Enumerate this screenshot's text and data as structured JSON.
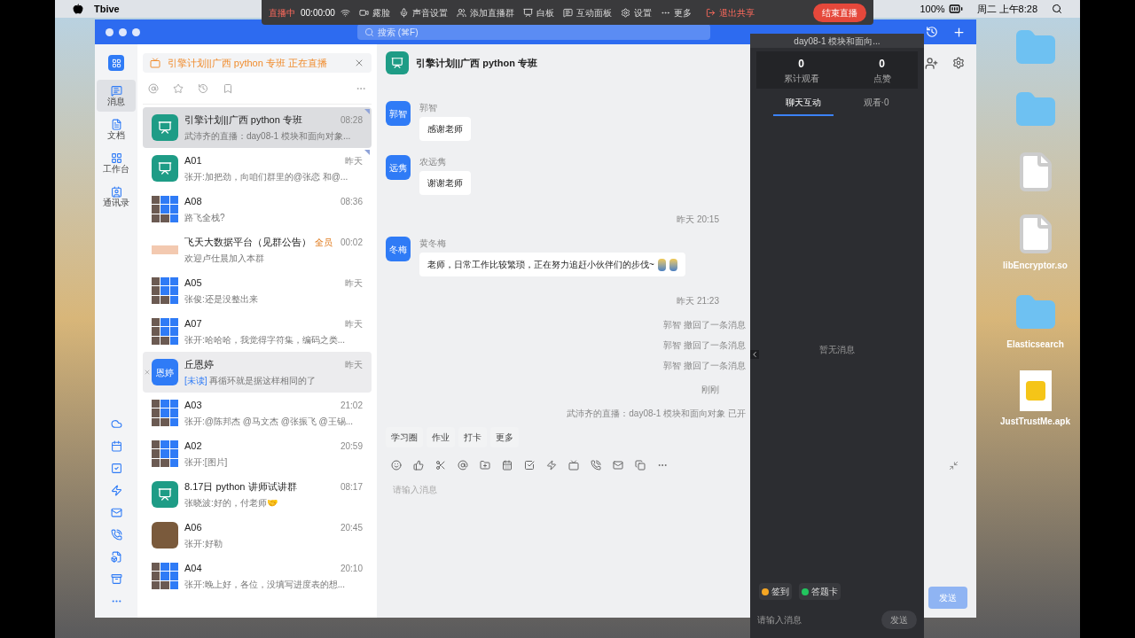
{
  "menubar": {
    "app_name": "Tbive",
    "battery": "100%",
    "clock": "周二 上午8:28"
  },
  "live_toolbar": {
    "status": "直播中",
    "timer": "00:00:00",
    "items": [
      {
        "kind": "camera",
        "label": "露脸"
      },
      {
        "kind": "mic",
        "label": "声音设置"
      },
      {
        "kind": "group",
        "label": "添加直播群"
      },
      {
        "kind": "board",
        "label": "白板"
      },
      {
        "kind": "chat",
        "label": "互动面板"
      },
      {
        "kind": "settings",
        "label": "设置"
      },
      {
        "kind": "more",
        "label": "更多"
      }
    ],
    "share": "退出共享",
    "end": "结束直播"
  },
  "app": {
    "search_placeholder": "搜索 (⌘F)",
    "nav": [
      {
        "kind": "message",
        "label": "消息",
        "selected": true
      },
      {
        "kind": "doc",
        "label": "文档",
        "selected": false
      },
      {
        "kind": "workbench",
        "label": "工作台",
        "selected": false
      },
      {
        "kind": "contacts",
        "label": "通讯录",
        "selected": false
      }
    ],
    "banner": "引擎计划||广西 python 专班 正在直播",
    "conversations": [
      {
        "avatar": {
          "kind": "group"
        },
        "name": "引擎计划||广西 python 专班",
        "preview": "武沛齐的直播：day08-1 模块和面向对象...",
        "time": "08:28",
        "selected": true,
        "hovered": false,
        "flagged": true
      },
      {
        "avatar": {
          "kind": "group"
        },
        "name": "A01",
        "preview": "张开:加把劲，向咱们群里的@张恋 和@...",
        "time": "昨天",
        "selected": false,
        "hovered": false,
        "flagged": true
      },
      {
        "avatar": {
          "kind": "grid"
        },
        "name": "A08",
        "preview": "路飞全栈?",
        "time": "08:36",
        "selected": false,
        "hovered": false,
        "flagged": false
      },
      {
        "avatar": {
          "kind": "logo"
        },
        "name": "飞天大数据平台（见群公告）",
        "tag": "全员",
        "preview": "欢迎卢仕晨加入本群",
        "time": "00:02",
        "selected": false,
        "hovered": false,
        "flagged": false
      },
      {
        "avatar": {
          "kind": "grid"
        },
        "name": "A05",
        "preview": "张俊:还是没整出来",
        "time": "昨天",
        "selected": false,
        "hovered": false,
        "flagged": false
      },
      {
        "avatar": {
          "kind": "grid"
        },
        "name": "A07",
        "preview": "张开:哈哈哈，我觉得字符集，编码之类...",
        "time": "昨天",
        "selected": false,
        "hovered": false,
        "flagged": false
      },
      {
        "avatar": {
          "kind": "initials",
          "text": "恩婷"
        },
        "name": "丘恩婷",
        "prefix": "[未读]",
        "preview": "再循环就是据这样相同的了",
        "time": "昨天",
        "selected": false,
        "hovered": true,
        "flagged": false
      },
      {
        "avatar": {
          "kind": "grid"
        },
        "name": "A03",
        "preview": "张开:@陈邦杰 @马文杰 @张振飞 @王锡...",
        "time": "21:02",
        "selected": false,
        "hovered": false,
        "flagged": false
      },
      {
        "avatar": {
          "kind": "grid"
        },
        "name": "A02",
        "preview": "张开:[图片]",
        "time": "20:59",
        "selected": false,
        "hovered": false,
        "flagged": false
      },
      {
        "avatar": {
          "kind": "group"
        },
        "name": "8.17日 python 讲师试讲群",
        "preview": "张晓波:好的，付老师🤝",
        "time": "08:17",
        "selected": false,
        "hovered": false,
        "flagged": false
      },
      {
        "avatar": {
          "kind": "photo"
        },
        "name": "A06",
        "preview": "张开:好勒",
        "time": "20:45",
        "selected": false,
        "hovered": false,
        "flagged": false
      },
      {
        "avatar": {
          "kind": "grid"
        },
        "name": "A04",
        "preview": "张开:晚上好，各位，没填写进度表的想...",
        "time": "20:10",
        "selected": false,
        "hovered": false,
        "flagged": false
      }
    ],
    "chat": {
      "title": "引擎计划||广西 python 专班",
      "messages": [
        {
          "kind": "message",
          "avatar_text": "郭智",
          "sender": "郭智",
          "text": "感谢老师"
        },
        {
          "kind": "message",
          "avatar_text": "远隽",
          "sender": "农远隽",
          "text": "谢谢老师"
        },
        {
          "kind": "time",
          "text": "昨天 20:15"
        },
        {
          "kind": "message",
          "avatar_text": "冬梅",
          "sender": "黄冬梅",
          "text": "老师，日常工作比较繁琐，正在努力追赶小伙伴们的步伐~",
          "emojis": [
            {
              "kind": "person"
            },
            {
              "kind": "person"
            }
          ]
        },
        {
          "kind": "time",
          "text": "昨天 21:23"
        },
        {
          "kind": "notice",
          "text": "郭智 撤回了一条消息"
        },
        {
          "kind": "notice",
          "text": "郭智 撤回了一条消息"
        },
        {
          "kind": "notice",
          "text": "郭智 撤回了一条消息"
        },
        {
          "kind": "time",
          "text": "刚刚"
        },
        {
          "kind": "notice",
          "text": "武沛齐的直播：day08-1 模块和面向对象 已开"
        }
      ],
      "tabs": [
        "学习圈",
        "作业",
        "打卡",
        "更多"
      ],
      "input_placeholder": "请输入消息",
      "send": "发送"
    }
  },
  "live_panel": {
    "title": "day08-1 模块和面向...",
    "stats": [
      {
        "value": "0",
        "label": "累计观看"
      },
      {
        "value": "0",
        "label": "点赞"
      }
    ],
    "tabs": [
      {
        "label": "聊天互动",
        "selected": true
      },
      {
        "label": "观看·0",
        "selected": false
      }
    ],
    "empty": "暂无消息",
    "actions": [
      {
        "label": "签到",
        "color": "#f5a623"
      },
      {
        "label": "答题卡",
        "color": "#22c55e"
      }
    ],
    "input_placeholder": "请输入消息",
    "send": "发送"
  },
  "desktop_icons": [
    {
      "kind": "folder"
    },
    {
      "kind": "folder"
    },
    {
      "kind": "document"
    },
    {
      "kind": "file",
      "label": "libEncryptor.so"
    },
    {
      "kind": "folder",
      "label": "Elasticsearch"
    },
    {
      "kind": "apk",
      "label": "JustTrustMe.apk"
    }
  ]
}
